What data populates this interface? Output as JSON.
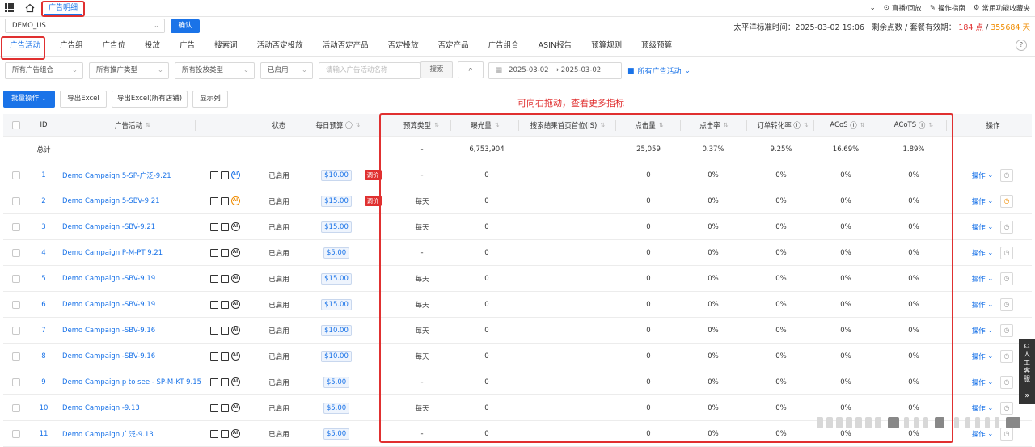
{
  "topbar": {
    "tab_label": "广告明细",
    "links": [
      "直播/回放",
      "操作指南",
      "常用功能收藏夹"
    ]
  },
  "store_bar": {
    "store": "DEMO_US",
    "confirm": "确认",
    "time_label": "太平洋标准时间：2025-03-02 19:06",
    "points_label": "剩余点数 / 套餐有效期：",
    "points": "184 点",
    "validity": "355684 天"
  },
  "nav_tabs": [
    "广告活动",
    "广告组",
    "广告位",
    "投放",
    "广告",
    "搜索词",
    "活动否定投放",
    "活动否定产品",
    "否定投放",
    "否定产品",
    "广告组合",
    "ASIN报告",
    "预算规则",
    "顶级预算"
  ],
  "filters": {
    "portfolio": "所有广告组合",
    "promo_type": "所有推广类型",
    "targeting_type": "所有投放类型",
    "status": "已启用",
    "search_placeholder": "请输入广告活动名称",
    "search_btn": "搜索",
    "date_start": "2025-03-02",
    "date_sep": "→",
    "date_end": "2025-03-02",
    "folder": "所有广告活动"
  },
  "actions": {
    "batch": "批量操作",
    "export": "导出Excel",
    "export_all": "导出Excel(所有店铺)",
    "columns": "显示列"
  },
  "hint": "可向右拖动，查看更多指标",
  "columns": {
    "id": "ID",
    "campaign": "广告活动",
    "status": "状态",
    "budget": "每日预算",
    "budget_type": "预算类型",
    "impressions": "曝光量",
    "top_is": "搜索结果首页首位(IS)",
    "clicks": "点击量",
    "ctr": "点击率",
    "cvr": "订单转化率",
    "acos": "ACoS",
    "acots": "ACoTS",
    "ops": "操作"
  },
  "total": {
    "label": "总计",
    "budget_type": "-",
    "impressions": "6,753,904",
    "clicks": "25,059",
    "ctr": "0.37%",
    "cvr": "9.25%",
    "acos": "16.69%",
    "acots": "1.89%"
  },
  "rows": [
    {
      "id": "1",
      "name": "Demo Campaign 5-SP-广泛-9.21",
      "ai": "blue",
      "status": "已启用",
      "budget": "$10.00",
      "tag": "调价",
      "budget_type": "-",
      "impressions": "0",
      "clicks": "0",
      "ctr": "0%",
      "cvr": "0%",
      "acos": "0%",
      "acots": "0%",
      "op": "操作",
      "clock": "gray"
    },
    {
      "id": "2",
      "name": "Demo Campaign 5-SBV-9.21",
      "ai": "orange",
      "status": "已启用",
      "budget": "$15.00",
      "tag": "调价",
      "budget_type": "每天",
      "impressions": "0",
      "clicks": "0",
      "ctr": "0%",
      "cvr": "0%",
      "acos": "0%",
      "acots": "0%",
      "op": "操作",
      "clock": "orange"
    },
    {
      "id": "3",
      "name": "Demo Campaign -SBV-9.21",
      "ai": "",
      "status": "已启用",
      "budget": "$15.00",
      "tag": "",
      "budget_type": "每天",
      "impressions": "0",
      "clicks": "0",
      "ctr": "0%",
      "cvr": "0%",
      "acos": "0%",
      "acots": "0%",
      "op": "操作",
      "clock": "gray"
    },
    {
      "id": "4",
      "name": "Demo Campaign P-M-PT 9.21",
      "ai": "",
      "status": "已启用",
      "budget": "$5.00",
      "tag": "",
      "budget_type": "-",
      "impressions": "0",
      "clicks": "0",
      "ctr": "0%",
      "cvr": "0%",
      "acos": "0%",
      "acots": "0%",
      "op": "操作",
      "clock": "gray"
    },
    {
      "id": "5",
      "name": "Demo Campaign -SBV-9.19",
      "ai": "",
      "status": "已启用",
      "budget": "$15.00",
      "tag": "",
      "budget_type": "每天",
      "impressions": "0",
      "clicks": "0",
      "ctr": "0%",
      "cvr": "0%",
      "acos": "0%",
      "acots": "0%",
      "op": "操作",
      "clock": "gray"
    },
    {
      "id": "6",
      "name": "Demo Campaign -SBV-9.19",
      "ai": "",
      "status": "已启用",
      "budget": "$15.00",
      "tag": "",
      "budget_type": "每天",
      "impressions": "0",
      "clicks": "0",
      "ctr": "0%",
      "cvr": "0%",
      "acos": "0%",
      "acots": "0%",
      "op": "操作",
      "clock": "gray"
    },
    {
      "id": "7",
      "name": "Demo Campaign -SBV-9.16",
      "ai": "",
      "status": "已启用",
      "budget": "$10.00",
      "tag": "",
      "budget_type": "每天",
      "impressions": "0",
      "clicks": "0",
      "ctr": "0%",
      "cvr": "0%",
      "acos": "0%",
      "acots": "0%",
      "op": "操作",
      "clock": "gray"
    },
    {
      "id": "8",
      "name": "Demo Campaign -SBV-9.16",
      "ai": "",
      "status": "已启用",
      "budget": "$10.00",
      "tag": "",
      "budget_type": "每天",
      "impressions": "0",
      "clicks": "0",
      "ctr": "0%",
      "cvr": "0%",
      "acos": "0%",
      "acots": "0%",
      "op": "操作",
      "clock": "gray"
    },
    {
      "id": "9",
      "name": "Demo Campaign p to see - SP-M-KT 9.15",
      "ai": "",
      "status": "已启用",
      "budget": "$5.00",
      "tag": "",
      "budget_type": "-",
      "impressions": "0",
      "clicks": "0",
      "ctr": "0%",
      "cvr": "0%",
      "acos": "0%",
      "acots": "0%",
      "op": "操作",
      "clock": "gray"
    },
    {
      "id": "10",
      "name": "Demo Campaign -9.13",
      "ai": "",
      "status": "已启用",
      "budget": "$5.00",
      "tag": "",
      "budget_type": "每天",
      "impressions": "0",
      "clicks": "0",
      "ctr": "0%",
      "cvr": "0%",
      "acos": "0%",
      "acots": "0%",
      "op": "操作",
      "clock": "gray"
    },
    {
      "id": "11",
      "name": "Demo Campaign 广泛-9.13",
      "ai": "",
      "status": "已启用",
      "budget": "$5.00",
      "tag": "",
      "budget_type": "-",
      "impressions": "0",
      "clicks": "0",
      "ctr": "0%",
      "cvr": "0%",
      "acos": "0%",
      "acots": "0%",
      "op": "操作",
      "clock": "gray"
    }
  ],
  "side": {
    "service": "人工客服",
    "expand": "»"
  },
  "colors": {
    "primary": "#1a73e8",
    "highlight": "#e03030",
    "warning": "#f08c00"
  }
}
